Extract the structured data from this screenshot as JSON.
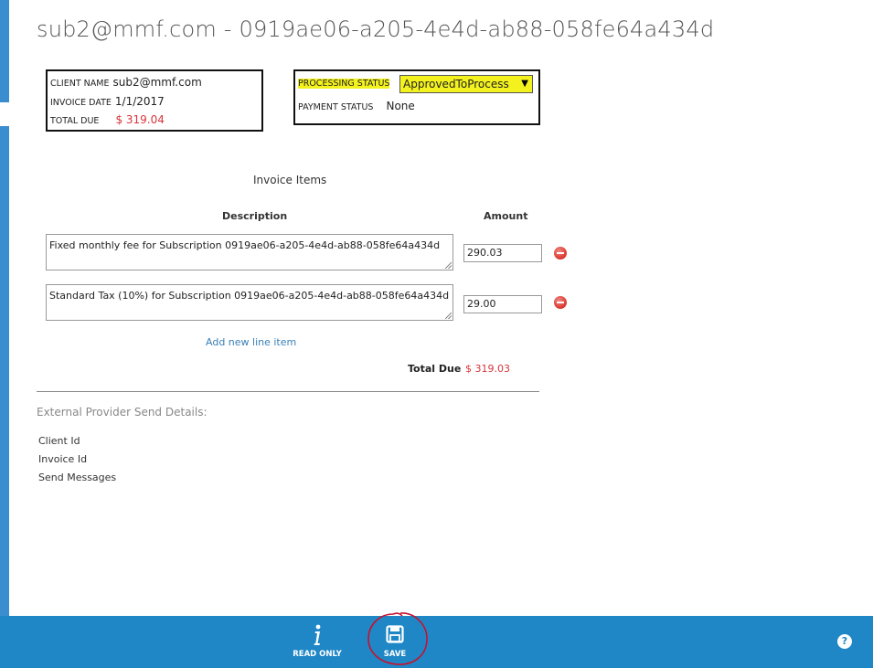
{
  "page": {
    "title": "sub2@mmf.com - 0919ae06-a205-4e4d-ab88-058fe64a434d"
  },
  "client_info": {
    "client_name_label": "CLIENT NAME",
    "client_name": "sub2@mmf.com",
    "invoice_date_label": "INVOICE DATE",
    "invoice_date": "1/1/2017",
    "total_due_label": "TOTAL DUE",
    "total_due": "$ 319.04"
  },
  "status_info": {
    "processing_status_label": "PROCESSING STATUS",
    "processing_status": "ApprovedToProcess",
    "payment_status_label": "PAYMENT STATUS",
    "payment_status": "None"
  },
  "invoice_items": {
    "title": "Invoice Items",
    "description_header": "Description",
    "amount_header": "Amount",
    "items": [
      {
        "description": "Fixed monthly fee for Subscription 0919ae06-a205-4e4d-ab88-058fe64a434d",
        "amount": "290.03"
      },
      {
        "description": "Standard Tax (10%) for Subscription 0919ae06-a205-4e4d-ab88-058fe64a434d",
        "amount": "29.00"
      }
    ],
    "add_line_label": "Add new line item",
    "total_due_label": "Total Due",
    "total_due": "$ 319.03"
  },
  "external_provider": {
    "title": "External Provider Send Details:",
    "fields": [
      "Client Id",
      "Invoice Id",
      "Send Messages"
    ]
  },
  "toolbar": {
    "read_only_label": "READ ONLY",
    "save_label": "SAVE",
    "help_symbol": "?"
  },
  "colors": {
    "accent": "#1f87c6",
    "highlight": "#f4f21e",
    "money_red": "#d9343a",
    "annotation": "#c8102e"
  }
}
